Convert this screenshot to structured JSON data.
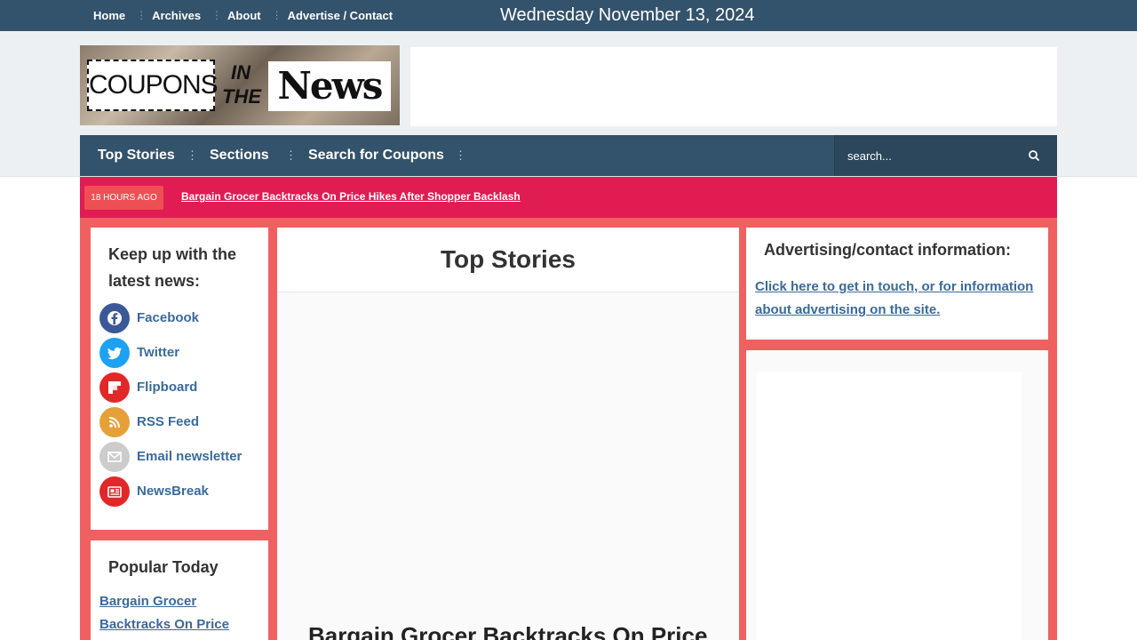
{
  "topbar": {
    "nav": [
      "Home",
      "Archives",
      "About",
      "Advertise / Contact"
    ],
    "date": "Wednesday November 13, 2024"
  },
  "logo": {
    "coupons": "COUPONS",
    "in": "IN",
    "the": "THE",
    "news": "News"
  },
  "mainnav": {
    "items": [
      "Top Stories",
      "Sections",
      "Search for Coupons"
    ],
    "search_placeholder": "search..."
  },
  "ticker": {
    "badge": "18 HOURS AGO",
    "headline": "Bargain Grocer Backtracks On Price Hikes After Shopper Backlash"
  },
  "left": {
    "keep_up_title": "Keep up with the latest news:",
    "social": [
      {
        "label": "Facebook",
        "icon": "facebook-icon",
        "color": "#3b5998"
      },
      {
        "label": "Twitter",
        "icon": "twitter-icon",
        "color": "#1da1f2"
      },
      {
        "label": "Flipboard",
        "icon": "flipboard-icon",
        "color": "#e12828"
      },
      {
        "label": "RSS Feed",
        "icon": "rss-icon",
        "color": "#e5a03a"
      },
      {
        "label": "Email newsletter",
        "icon": "email-icon",
        "color": "#cccccc"
      },
      {
        "label": "NewsBreak",
        "icon": "newsbreak-icon",
        "color": "#e12828"
      }
    ],
    "popular_title": "Popular Today",
    "popular_link": "Bargain Grocer Backtracks On Price Hikes"
  },
  "center": {
    "title": "Top Stories",
    "headline": "Bargain Grocer Backtracks On Price"
  },
  "right": {
    "title": "Advertising/contact information:",
    "link": "Click here to get in touch, or for information about advertising on the site."
  },
  "colors": {
    "nav_bg": "#33526b",
    "ticker_bg": "#e01c52",
    "frame": "#f06060",
    "link": "#3b6a9a"
  }
}
